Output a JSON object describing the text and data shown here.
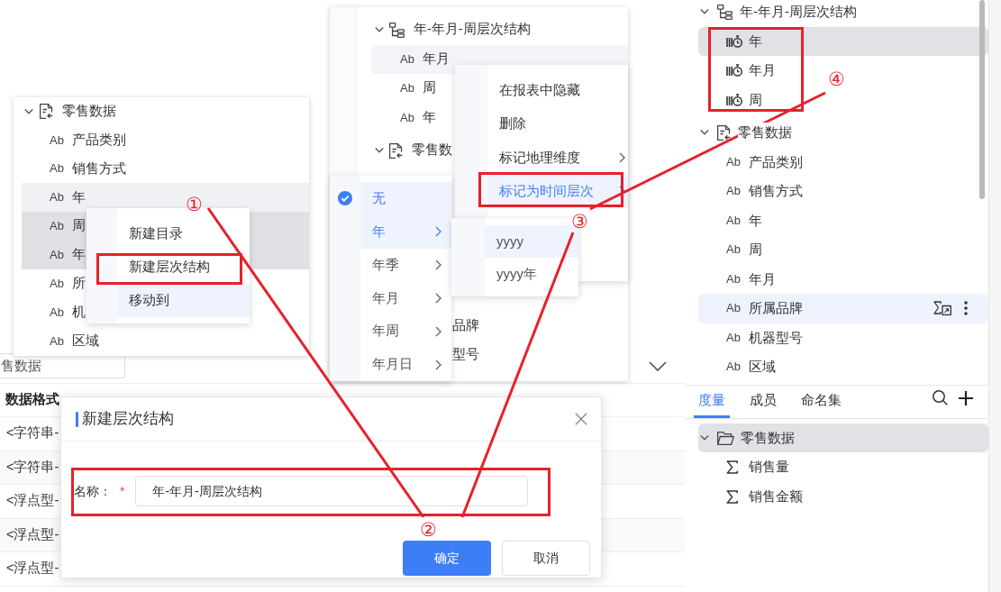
{
  "left_panel": {
    "tree": {
      "kind": "table",
      "label": "零售数据",
      "expanded": true,
      "children": [
        {
          "kind": "dimension",
          "type_label": "Ab",
          "label": "产品类别",
          "selected": false,
          "hovered": false
        },
        {
          "kind": "dimension",
          "type_label": "Ab",
          "label": "销售方式",
          "selected": false,
          "hovered": false
        },
        {
          "kind": "dimension",
          "type_label": "Ab",
          "label": "年",
          "selected": false,
          "hovered": true
        },
        {
          "kind": "dimension",
          "type_label": "Ab",
          "label": "周",
          "selected": true,
          "hovered": false
        },
        {
          "kind": "dimension",
          "type_label": "Ab",
          "label": "年",
          "selected": true,
          "hovered": false
        },
        {
          "kind": "dimension",
          "type_label": "Ab",
          "label": "所",
          "selected": false,
          "hovered": false
        },
        {
          "kind": "dimension",
          "type_label": "Ab",
          "label": "机",
          "selected": false,
          "hovered": false
        },
        {
          "kind": "dimension",
          "type_label": "Ab",
          "label": "区域",
          "selected": false,
          "hovered": false
        }
      ]
    },
    "context_menu": {
      "items": [
        {
          "label": "新建目录",
          "active": false
        },
        {
          "label": "新建层次结构",
          "active": false
        },
        {
          "label": "移动到",
          "active": true
        }
      ]
    }
  },
  "middle_panel": {
    "tree": [
      {
        "kind": "hierarchy",
        "label": "年-年月-周层次结构",
        "expanded": true,
        "children": [
          {
            "kind": "dimension",
            "type_label": "Ab",
            "label": "年月",
            "hovered": true
          },
          {
            "kind": "dimension",
            "type_label": "Ab",
            "label": "周",
            "hovered": false
          },
          {
            "kind": "dimension",
            "type_label": "Ab",
            "label": "年",
            "hovered": false
          }
        ]
      },
      {
        "kind": "table",
        "label": "零售数",
        "expanded": true
      }
    ],
    "obscured_labels": [
      "品牌",
      "型号"
    ],
    "context_menu": {
      "items": [
        {
          "label": "在报表中隐藏",
          "has_submenu": false,
          "active": false
        },
        {
          "label": "删除",
          "has_submenu": false,
          "active": false
        },
        {
          "label": "标记地理维度",
          "has_submenu": true,
          "active": false
        },
        {
          "label": "标记为时间层次",
          "has_submenu": true,
          "active": true
        }
      ]
    },
    "time_level_menu": {
      "items": [
        {
          "label": "无",
          "checked": true,
          "has_submenu": false,
          "active": true
        },
        {
          "label": "年",
          "checked": false,
          "has_submenu": true,
          "active": true
        },
        {
          "label": "年季",
          "checked": false,
          "has_submenu": true,
          "active": false
        },
        {
          "label": "年月",
          "checked": false,
          "has_submenu": true,
          "active": false
        },
        {
          "label": "年周",
          "checked": false,
          "has_submenu": true,
          "active": false
        },
        {
          "label": "年月日",
          "checked": false,
          "has_submenu": true,
          "active": false
        }
      ]
    },
    "format_menu": {
      "items": [
        {
          "label": "yyyy",
          "active": true
        },
        {
          "label": "yyyy年",
          "active": false
        }
      ]
    }
  },
  "right_panel": {
    "tree": [
      {
        "kind": "hierarchy",
        "label": "年-年月-周层次结构",
        "expanded": true,
        "children": [
          {
            "kind": "time",
            "label": "年",
            "selected": true,
            "hovered": false
          },
          {
            "kind": "time",
            "label": "年月",
            "selected": false,
            "hovered": false
          },
          {
            "kind": "time",
            "label": "周",
            "selected": false,
            "hovered": false
          }
        ]
      },
      {
        "kind": "table",
        "label": "零售数据",
        "expanded": true,
        "children": [
          {
            "kind": "dimension",
            "type_label": "Ab",
            "label": "产品类别",
            "selected": false,
            "hovered": false
          },
          {
            "kind": "dimension",
            "type_label": "Ab",
            "label": "销售方式",
            "selected": false,
            "hovered": false
          },
          {
            "kind": "dimension",
            "type_label": "Ab",
            "label": "年",
            "selected": false,
            "hovered": false
          },
          {
            "kind": "dimension",
            "type_label": "Ab",
            "label": "周",
            "selected": false,
            "hovered": false
          },
          {
            "kind": "dimension",
            "type_label": "Ab",
            "label": "年月",
            "selected": false,
            "hovered": false
          },
          {
            "kind": "dimension",
            "type_label": "Ab",
            "label": "所属品牌",
            "selected": false,
            "hovered": true
          },
          {
            "kind": "dimension",
            "type_label": "Ab",
            "label": "机器型号",
            "selected": false,
            "hovered": false
          },
          {
            "kind": "dimension",
            "type_label": "Ab",
            "label": "区域",
            "selected": false,
            "hovered": false
          }
        ]
      }
    ],
    "tabs": [
      {
        "label": "度量",
        "selected": true
      },
      {
        "label": "成员",
        "selected": false
      },
      {
        "label": "命名集",
        "selected": false
      }
    ],
    "measures": {
      "kind": "folder",
      "label": "零售数据",
      "expanded": true,
      "selected": true,
      "children": [
        {
          "kind": "measure",
          "label": "销售量"
        },
        {
          "kind": "measure",
          "label": "销售金额"
        }
      ]
    }
  },
  "background": {
    "source_field": {
      "value": "售数据"
    },
    "table": {
      "header": "数据格式",
      "rows": [
        "<字符串-",
        "<字符串-",
        "<浮点型-",
        "<浮点型-",
        "<浮点型-"
      ]
    }
  },
  "dialog": {
    "title": "新建层次结构",
    "field": {
      "label": "名称：",
      "required_mark": "*",
      "value": "年-年月-周层次结构"
    },
    "buttons": [
      {
        "label": "确定",
        "kind": "primary"
      },
      {
        "label": "取消",
        "kind": "secondary"
      }
    ]
  },
  "annotations": {
    "step_markers": [
      "①",
      "②",
      "③",
      "④"
    ]
  }
}
